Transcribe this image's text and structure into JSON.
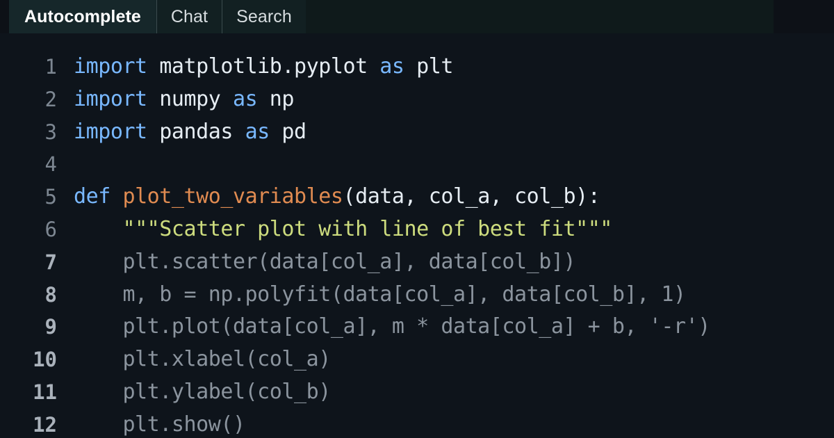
{
  "window": {
    "background": "#0d1117",
    "code_background": "#0e141b"
  },
  "tabs": {
    "items": [
      {
        "label": "Autocomplete",
        "active": true
      },
      {
        "label": "Chat",
        "active": false
      },
      {
        "label": "Search",
        "active": false
      }
    ],
    "active_tab": "Autocomplete",
    "active_background": "#16272a",
    "inactive_background": "#122022",
    "bar_background": "#121b1c"
  },
  "editor": {
    "language": "python",
    "tab_size": 4,
    "colors": {
      "keyword": "#79b8ff",
      "function": "#e08b51",
      "plain": "#e6edf3",
      "string": "#cddc7e",
      "ghost": "#8b949e",
      "line_number": "#7d8792",
      "line_number_active": "#aab2bb"
    },
    "lines": [
      {
        "number": "1",
        "ghost": false,
        "text": "import matplotlib.pyplot as plt",
        "tokens": [
          {
            "t": "import",
            "k": "kw"
          },
          {
            "t": " matplotlib.pyplot ",
            "k": "plain"
          },
          {
            "t": "as",
            "k": "kw"
          },
          {
            "t": " plt",
            "k": "plain"
          }
        ]
      },
      {
        "number": "2",
        "ghost": false,
        "text": "import numpy as np",
        "tokens": [
          {
            "t": "import",
            "k": "kw"
          },
          {
            "t": " numpy ",
            "k": "plain"
          },
          {
            "t": "as",
            "k": "kw"
          },
          {
            "t": " np",
            "k": "plain"
          }
        ]
      },
      {
        "number": "3",
        "ghost": false,
        "text": "import pandas as pd",
        "tokens": [
          {
            "t": "import",
            "k": "kw"
          },
          {
            "t": " pandas ",
            "k": "plain"
          },
          {
            "t": "as",
            "k": "kw"
          },
          {
            "t": " pd",
            "k": "plain"
          }
        ]
      },
      {
        "number": "4",
        "ghost": false,
        "text": "",
        "tokens": []
      },
      {
        "number": "5",
        "ghost": false,
        "text": "def plot_two_variables(data, col_a, col_b):",
        "tokens": [
          {
            "t": "def ",
            "k": "kw"
          },
          {
            "t": "plot_two_variables",
            "k": "fn"
          },
          {
            "t": "(data, col_a, col_b):",
            "k": "plain"
          }
        ]
      },
      {
        "number": "6",
        "ghost": false,
        "text": "    \"\"\"Scatter plot with line of best fit\"\"\"",
        "tokens": [
          {
            "t": "    ",
            "k": "plain"
          },
          {
            "t": "\"\"\"Scatter plot with line of best fit\"\"\"",
            "k": "str"
          }
        ]
      },
      {
        "number": "7",
        "ghost": true,
        "text": "    plt.scatter(data[col_a], data[col_b])",
        "tokens": [
          {
            "t": "    plt.scatter(data[col_a], data[col_b])",
            "k": "ghost"
          }
        ]
      },
      {
        "number": "8",
        "ghost": true,
        "text": "    m, b = np.polyfit(data[col_a], data[col_b], 1)",
        "tokens": [
          {
            "t": "    m, b = np.polyfit(data[col_a], data[col_b], 1)",
            "k": "ghost"
          }
        ]
      },
      {
        "number": "9",
        "ghost": true,
        "text": "    plt.plot(data[col_a], m * data[col_a] + b, '-r')",
        "tokens": [
          {
            "t": "    plt.plot(data[col_a], m * data[col_a] + b, '-r')",
            "k": "ghost"
          }
        ]
      },
      {
        "number": "10",
        "ghost": true,
        "text": "    plt.xlabel(col_a)",
        "tokens": [
          {
            "t": "    plt.xlabel(col_a)",
            "k": "ghost"
          }
        ]
      },
      {
        "number": "11",
        "ghost": true,
        "text": "    plt.ylabel(col_b)",
        "tokens": [
          {
            "t": "    plt.ylabel(col_b)",
            "k": "ghost"
          }
        ]
      },
      {
        "number": "12",
        "ghost": true,
        "text": "    plt.show()",
        "tokens": [
          {
            "t": "    plt.show()",
            "k": "ghost"
          }
        ]
      }
    ]
  }
}
